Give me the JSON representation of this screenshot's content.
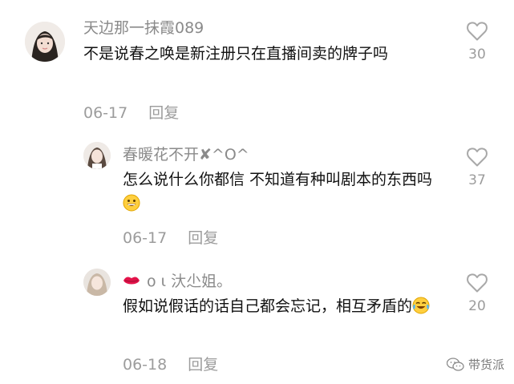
{
  "comments": [
    {
      "username": "天边那一抹霞089",
      "text": "不是说春之唤是新注册只在直播间卖的牌子吗",
      "date": "06-17",
      "reply_label": "回复",
      "likes": "30"
    },
    {
      "username": "春暖花不开✘^O^",
      "text": "怎么说什么你都信 不知道有种叫剧本的东西吗",
      "emoji": "grinning-face-emoji",
      "date": "06-17",
      "reply_label": "回复",
      "likes": "37"
    },
    {
      "username_prefix_emoji": "lips-emoji",
      "username": "ο ι 汏尐姐。",
      "text": "假如说假话的话自己都会忘记，相互矛盾的",
      "emoji": "tears-of-joy-emoji",
      "date": "06-18",
      "reply_label": "回复",
      "likes": "20"
    }
  ],
  "watermark": {
    "label": "带货派",
    "icon": "wechat-icon"
  },
  "colors": {
    "username": "#8a8a8a",
    "content": "#111111",
    "meta": "#9c9c9c"
  }
}
